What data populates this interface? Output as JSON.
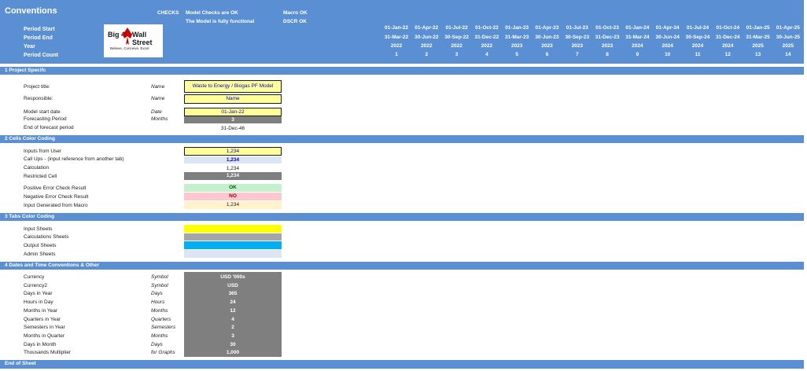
{
  "header": {
    "title": "Conventions",
    "checks_label": "CHECKS",
    "model_checks": "Model Checks are OK",
    "model_functional": "The Model is fully functional",
    "macro_ok": "Macro OK",
    "dscr_ok": "DSCR OK",
    "row_labels": [
      "Period Start",
      "Period End",
      "Year",
      "Period Count"
    ],
    "logo": {
      "big": "Big 4",
      "wall": "Wall Street",
      "tagline": "Believe, Conceive, Excel"
    }
  },
  "periods": [
    {
      "start": "01-Jan-22",
      "end": "31-Mar-22",
      "year": "2022",
      "count": "1"
    },
    {
      "start": "01-Apr-22",
      "end": "30-Jun-22",
      "year": "2022",
      "count": "2"
    },
    {
      "start": "01-Jul-22",
      "end": "30-Sep-22",
      "year": "2022",
      "count": "3"
    },
    {
      "start": "01-Oct-22",
      "end": "31-Dec-22",
      "year": "2022",
      "count": "4"
    },
    {
      "start": "01-Jan-23",
      "end": "31-Mar-23",
      "year": "2023",
      "count": "5"
    },
    {
      "start": "01-Apr-23",
      "end": "30-Jun-23",
      "year": "2023",
      "count": "6"
    },
    {
      "start": "01-Jul-23",
      "end": "30-Sep-23",
      "year": "2023",
      "count": "7"
    },
    {
      "start": "01-Oct-23",
      "end": "31-Dec-23",
      "year": "2023",
      "count": "8"
    },
    {
      "start": "01-Jan-24",
      "end": "31-Mar-24",
      "year": "2024",
      "count": "9"
    },
    {
      "start": "01-Apr-24",
      "end": "30-Jun-24",
      "year": "2024",
      "count": "10"
    },
    {
      "start": "01-Jul-24",
      "end": "30-Sep-24",
      "year": "2024",
      "count": "11"
    },
    {
      "start": "01-Oct-24",
      "end": "31-Dec-24",
      "year": "2024",
      "count": "12"
    },
    {
      "start": "01-Jan-25",
      "end": "31-Mar-25",
      "year": "2025",
      "count": "13"
    },
    {
      "start": "01-Apr-25",
      "end": "30-Jun-25",
      "year": "2025",
      "count": "14"
    }
  ],
  "sections": {
    "project": "1  Project Specifc",
    "colors": "2  Cells Color Coding",
    "tabs": "3  Tabs Color Coding",
    "dates": "4  Dates and Time Conventions & Other",
    "end": "End of Sheet"
  },
  "project": {
    "title_label": "Project title:",
    "title_unit": "Name",
    "title_value": "Waste to Energy / Biogas PF Model",
    "resp_label": "Responsible:",
    "resp_unit": "Name",
    "resp_value": "Name",
    "start_label": "Model start date",
    "start_unit": "Date",
    "start_value": "01-Jan-22",
    "fp_label": "Forecasting Period",
    "fp_unit": "Months",
    "fp_value": "3",
    "end_label": "End of forecast period",
    "end_value": "31-Dec-46"
  },
  "colors": {
    "input_label": "Inputs from User",
    "input_value": "1,234",
    "callup_label": "Call Ups - (input reference from another tab)",
    "callup_value": "1,234",
    "calc_label": "Calculation",
    "calc_value": "1,234",
    "restrict_label": "Restricted Cell",
    "restrict_value": "1,234",
    "pos_label": "Positive Error Check Result",
    "pos_value": "OK",
    "neg_label": "Negative Error Check Result",
    "neg_value": "NO",
    "macro_label": "Input Generated from Macro",
    "macro_value": "1,234"
  },
  "tabs": {
    "input": "Input Sheets",
    "calc": "Calculations Sheets",
    "output": "Output Sheets",
    "admin": "Admin Sheets"
  },
  "dates": [
    {
      "label": "Currency",
      "unit": "Symbol",
      "value": "USD '000s"
    },
    {
      "label": "Currency2",
      "unit": "Symbol",
      "value": "USD"
    },
    {
      "label": "Days in Year",
      "unit": "Days",
      "value": "365"
    },
    {
      "label": "Hours in Day",
      "unit": "Hours",
      "value": "24"
    },
    {
      "label": "Months in Year",
      "unit": "Months",
      "value": "12"
    },
    {
      "label": "Quarters in Year",
      "unit": "Quarters",
      "value": "4"
    },
    {
      "label": "Semesters in Year",
      "unit": "Semesters",
      "value": "2"
    },
    {
      "label": "Months in Quarter",
      "unit": "Months",
      "value": "3"
    },
    {
      "label": "Days in Month",
      "unit": "Days",
      "value": "30"
    },
    {
      "label": "Thousands Multiplier",
      "unit": "for Graphs",
      "value": "1,000"
    }
  ]
}
